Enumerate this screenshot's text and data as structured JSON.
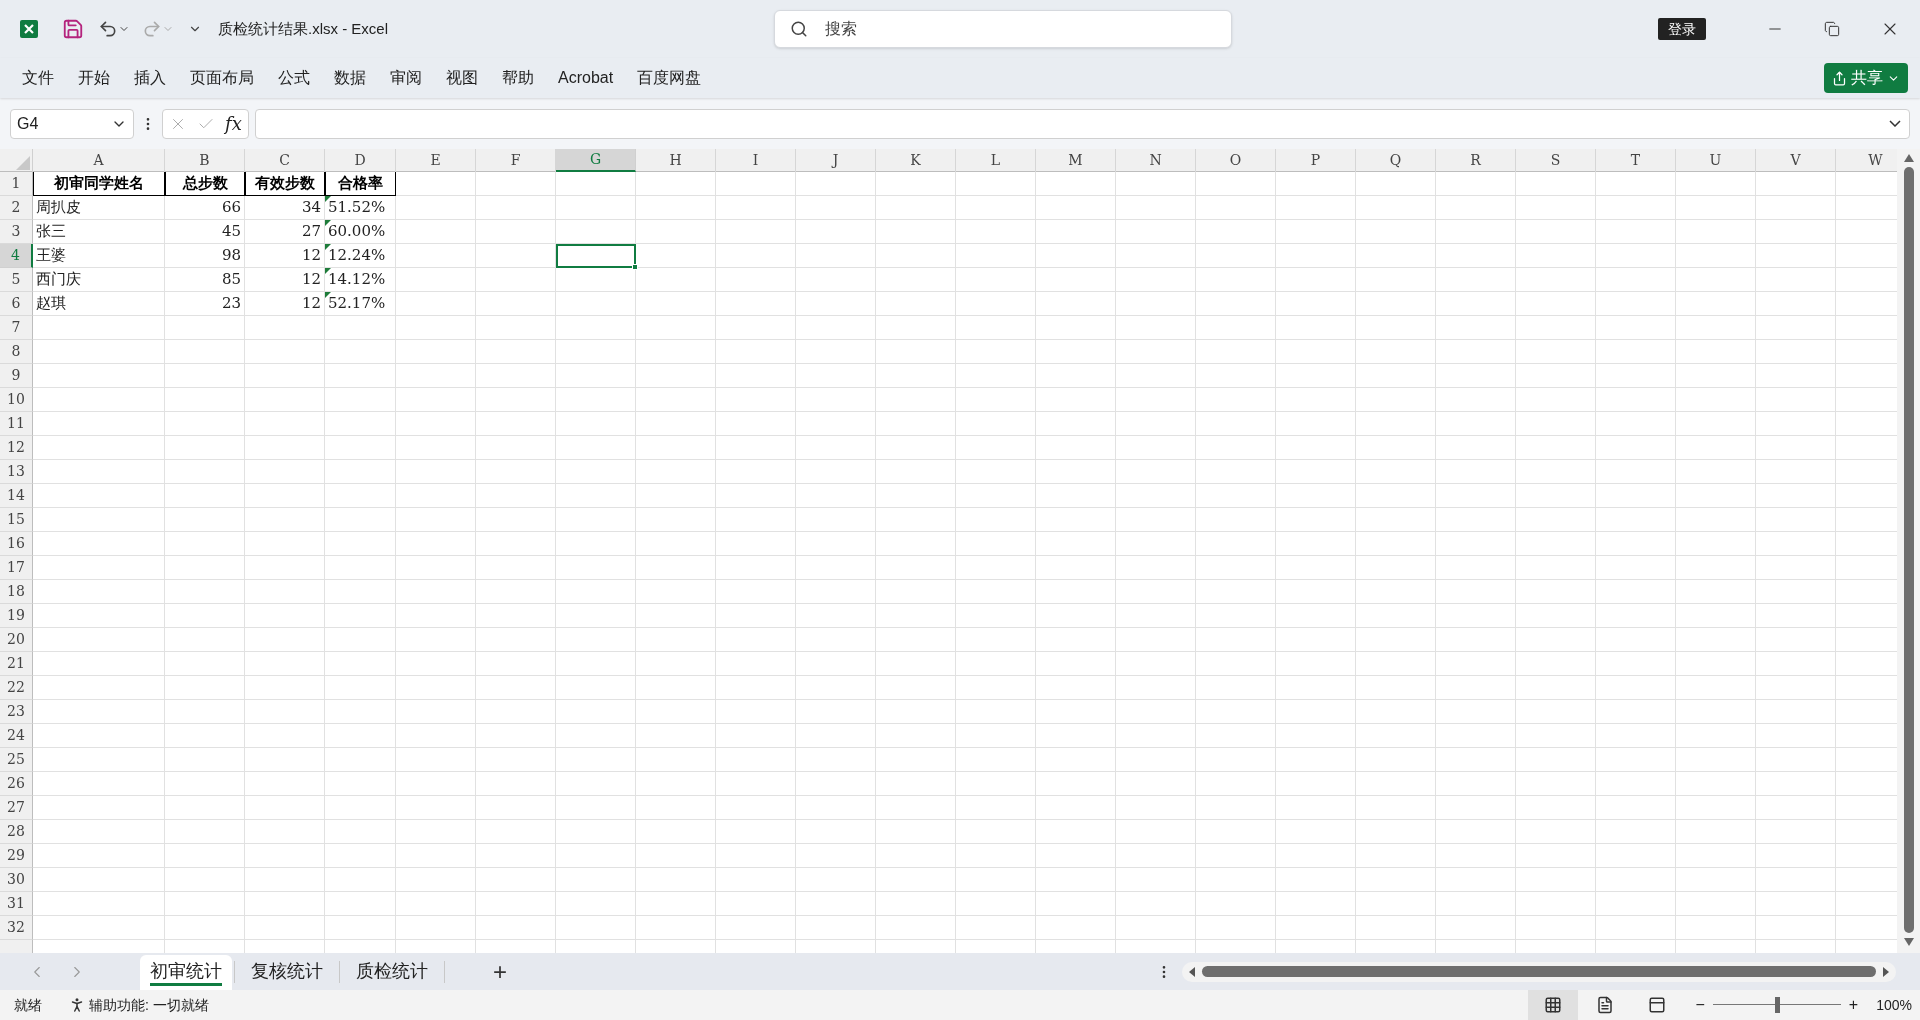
{
  "title_bar": {
    "title": "质检统计结果.xlsx  -  Excel",
    "search_placeholder": "搜索",
    "sign_in": "登录"
  },
  "menu": [
    "文件",
    "开始",
    "插入",
    "页面布局",
    "公式",
    "数据",
    "审阅",
    "视图",
    "帮助",
    "Acrobat",
    "百度网盘"
  ],
  "share_button": "共享",
  "formula_bar": {
    "name_box": "G4",
    "function_button": "fx"
  },
  "sheet": {
    "columns": [
      {
        "label": "A",
        "selected": false
      },
      {
        "label": "B",
        "selected": false
      },
      {
        "label": "C",
        "selected": false
      },
      {
        "label": "D",
        "selected": false
      },
      {
        "label": "E",
        "selected": false
      },
      {
        "label": "F",
        "selected": false
      },
      {
        "label": "G",
        "selected": true
      },
      {
        "label": "H",
        "selected": false
      },
      {
        "label": "I",
        "selected": false
      },
      {
        "label": "J",
        "selected": false
      },
      {
        "label": "K",
        "selected": false
      },
      {
        "label": "L",
        "selected": false
      },
      {
        "label": "M",
        "selected": false
      },
      {
        "label": "N",
        "selected": false
      },
      {
        "label": "O",
        "selected": false
      },
      {
        "label": "P",
        "selected": false
      },
      {
        "label": "Q",
        "selected": false
      },
      {
        "label": "R",
        "selected": false
      },
      {
        "label": "S",
        "selected": false
      },
      {
        "label": "T",
        "selected": false
      },
      {
        "label": "U",
        "selected": false
      },
      {
        "label": "V",
        "selected": false
      },
      {
        "label": "W",
        "selected": false
      }
    ],
    "rows": [
      {
        "label": "1",
        "selected": false,
        "cells": [
          {
            "text": "初审同学姓名",
            "kind": "header",
            "flagged": false
          },
          {
            "text": "总步数",
            "kind": "header",
            "flagged": false
          },
          {
            "text": "有效步数",
            "kind": "header",
            "flagged": false
          },
          {
            "text": "合格率",
            "kind": "header",
            "flagged": false
          }
        ]
      },
      {
        "label": "2",
        "selected": false,
        "cells": [
          {
            "text": "周扒皮",
            "kind": "text",
            "flagged": false
          },
          {
            "text": "66",
            "kind": "number",
            "flagged": false
          },
          {
            "text": "34",
            "kind": "number",
            "flagged": false
          },
          {
            "text": "51.52%",
            "kind": "text",
            "flagged": true
          }
        ]
      },
      {
        "label": "3",
        "selected": false,
        "cells": [
          {
            "text": "张三",
            "kind": "text",
            "flagged": false
          },
          {
            "text": "45",
            "kind": "number",
            "flagged": false
          },
          {
            "text": "27",
            "kind": "number",
            "flagged": false
          },
          {
            "text": "60.00%",
            "kind": "text",
            "flagged": true
          }
        ]
      },
      {
        "label": "4",
        "selected": true,
        "cells": [
          {
            "text": "王婆",
            "kind": "text",
            "flagged": false
          },
          {
            "text": "98",
            "kind": "number",
            "flagged": false
          },
          {
            "text": "12",
            "kind": "number",
            "flagged": false
          },
          {
            "text": "12.24%",
            "kind": "text",
            "flagged": true
          }
        ]
      },
      {
        "label": "5",
        "selected": false,
        "cells": [
          {
            "text": "西门庆",
            "kind": "text",
            "flagged": false
          },
          {
            "text": "85",
            "kind": "number",
            "flagged": false
          },
          {
            "text": "12",
            "kind": "number",
            "flagged": false
          },
          {
            "text": "14.12%",
            "kind": "text",
            "flagged": true
          }
        ]
      },
      {
        "label": "6",
        "selected": false,
        "cells": [
          {
            "text": "赵琪",
            "kind": "text",
            "flagged": false
          },
          {
            "text": "23",
            "kind": "number",
            "flagged": false
          },
          {
            "text": "12",
            "kind": "number",
            "flagged": false
          },
          {
            "text": "52.17%",
            "kind": "text",
            "flagged": true
          }
        ]
      },
      {
        "label": "7",
        "selected": false
      },
      {
        "label": "8",
        "selected": false
      },
      {
        "label": "9",
        "selected": false
      },
      {
        "label": "10",
        "selected": false
      },
      {
        "label": "11",
        "selected": false
      },
      {
        "label": "12",
        "selected": false
      },
      {
        "label": "13",
        "selected": false
      },
      {
        "label": "14",
        "selected": false
      },
      {
        "label": "15",
        "selected": false
      },
      {
        "label": "16",
        "selected": false
      },
      {
        "label": "17",
        "selected": false
      },
      {
        "label": "18",
        "selected": false
      },
      {
        "label": "19",
        "selected": false
      },
      {
        "label": "20",
        "selected": false
      },
      {
        "label": "21",
        "selected": false
      },
      {
        "label": "22",
        "selected": false
      },
      {
        "label": "23",
        "selected": false
      },
      {
        "label": "24",
        "selected": false
      },
      {
        "label": "25",
        "selected": false
      },
      {
        "label": "26",
        "selected": false
      },
      {
        "label": "27",
        "selected": false
      },
      {
        "label": "28",
        "selected": false
      },
      {
        "label": "29",
        "selected": false
      },
      {
        "label": "30",
        "selected": false
      },
      {
        "label": "31",
        "selected": false
      },
      {
        "label": "32",
        "selected": false
      }
    ]
  },
  "sheet_tabs": [
    {
      "label": "初审统计",
      "selected": true
    },
    {
      "label": "复核统计",
      "selected": false
    },
    {
      "label": "质检统计",
      "selected": false
    }
  ],
  "add_sheet": "+",
  "status_bar": {
    "ready": "就绪",
    "accessibility": "辅助功能: 一切就绪",
    "views": [
      {
        "kind": "normal",
        "selected": true
      },
      {
        "kind": "page_layout",
        "selected": false
      },
      {
        "kind": "page_break",
        "selected": false
      }
    ],
    "zoom_out": "−",
    "zoom_in": "+",
    "zoom_slider": {
      "level": 0.5
    },
    "zoom": "100%"
  }
}
